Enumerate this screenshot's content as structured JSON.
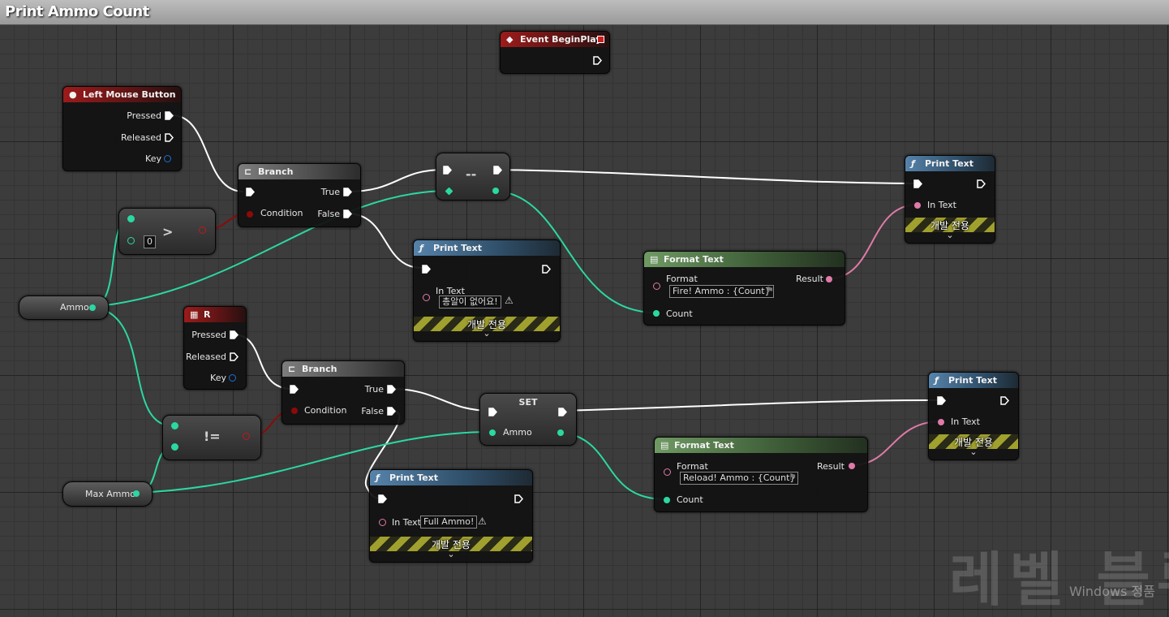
{
  "window": {
    "title": "Print Ammo Count"
  },
  "colors": {
    "exec": "#ffffff",
    "float_pin": "#2bd8a2",
    "bool_pin": "#8b0a0a",
    "string_pin": "#e07aa8",
    "key_pin": "#1f6fd6"
  },
  "nodes": {
    "event_begin": {
      "title": "Event BeginPlay"
    },
    "lmb": {
      "title": "Left Mouse Button",
      "pressed": "Pressed",
      "released": "Released",
      "key": "Key"
    },
    "branch1": {
      "title": "Branch",
      "condition": "Condition",
      "true": "True",
      "false": "False"
    },
    "greater": {
      "op": ">",
      "b_value": "0"
    },
    "decrement": {
      "op": "--"
    },
    "ammo_var": {
      "label": "Ammo"
    },
    "print1": {
      "title": "Print Text",
      "in_text": "In Text",
      "dev_only": "개발 전용"
    },
    "print2": {
      "title": "Print Text",
      "in_text": "In Text",
      "value": "총알이 없어요!",
      "dev_only": "개발 전용"
    },
    "format1": {
      "title": "Format Text",
      "format": "Format",
      "value": "Fire! Ammo : {Count}",
      "result": "Result",
      "count": "Count"
    },
    "key_r": {
      "title": "R",
      "pressed": "Pressed",
      "released": "Released",
      "key": "Key"
    },
    "branch2": {
      "title": "Branch",
      "condition": "Condition",
      "true": "True",
      "false": "False"
    },
    "notequal": {
      "op": "!="
    },
    "set": {
      "title": "SET",
      "ammo": "Ammo"
    },
    "max_ammo_var": {
      "label": "Max Ammo"
    },
    "print3": {
      "title": "Print Text",
      "in_text": "In Text",
      "dev_only": "개발 전용"
    },
    "print4": {
      "title": "Print Text",
      "in_text": "In Text",
      "value": "Full Ammo!",
      "dev_only": "개발 전용"
    },
    "format2": {
      "title": "Format Text",
      "format": "Format",
      "value": "Reload! Ammo : {Count}",
      "result": "Result",
      "count": "Count"
    }
  },
  "watermark": {
    "text": "레벨 블루",
    "windows": "Windows 정품"
  }
}
